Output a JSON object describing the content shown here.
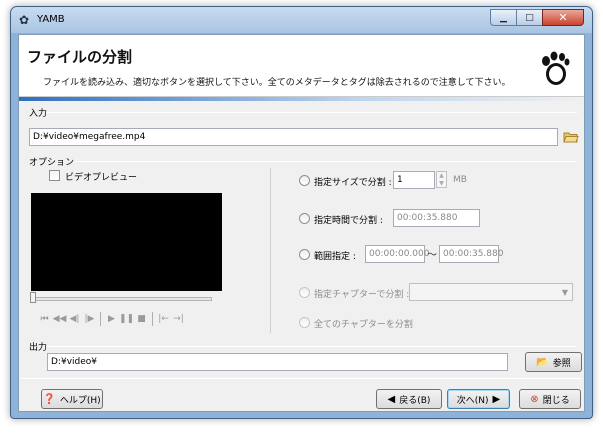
{
  "window": {
    "title": "YAMB"
  },
  "header": {
    "title": "ファイルの分割",
    "description": "ファイルを読み込み、適切なボタンを選択して下さい。全てのメタデータとタグは除去されるので注意して下さい。"
  },
  "input": {
    "label": "入力",
    "path": "D:¥video¥megafree.mp4"
  },
  "options": {
    "label": "オプション",
    "video_preview_label": "ビデオプレビュー",
    "split_size": {
      "label": "指定サイズで分割 :",
      "value": "1",
      "unit": "MB"
    },
    "split_time": {
      "label": "指定時間で分割 :",
      "value": "00:00:35.880"
    },
    "range": {
      "label": "範囲指定 :",
      "from": "00:00:00.000",
      "separator": "〜",
      "to": "00:00:35.880"
    },
    "split_chapter": {
      "label": "指定チャプターで分割 :"
    },
    "split_all_chapters": {
      "label": "全てのチャプターを分割"
    }
  },
  "output": {
    "label": "出力",
    "path": "D:¥video¥",
    "browse_label": "参照"
  },
  "footer": {
    "help_label": "ヘルプ(H)",
    "back_label": "戻る(B)",
    "next_label": "次へ(N)",
    "close_label": "閉じる"
  },
  "colors": {
    "accent": "#2f6fc0",
    "close_button": "#c8432f",
    "preview_bg": "#000000"
  }
}
